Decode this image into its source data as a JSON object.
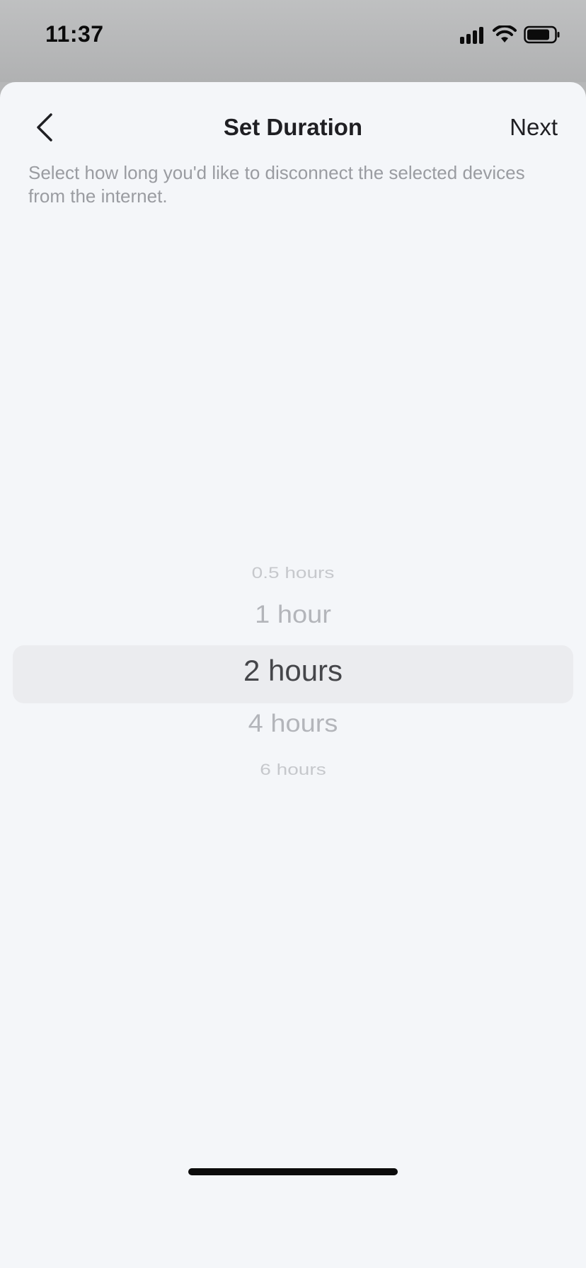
{
  "status_bar": {
    "time": "11:37",
    "icons": [
      "signal-icon",
      "wifi-icon",
      "battery-icon"
    ]
  },
  "header": {
    "back_icon": "chevron-left-icon",
    "title": "Set Duration",
    "next_label": "Next"
  },
  "description": "Select how long you'd like to disconnect the selected devices from the internet.",
  "picker": {
    "options": [
      "0.5 hours",
      "1 hour",
      "2 hours",
      "4 hours",
      "6 hours"
    ],
    "selected": "2 hours"
  },
  "colors": {
    "sheet_background": "#f4f6f9",
    "title_text": "#1f1f23",
    "description_text": "#9a9ca1",
    "picker_selected_text": "#45464a",
    "picker_unselected_text": "#b3b5ba",
    "picker_highlight": "#ebecef"
  }
}
